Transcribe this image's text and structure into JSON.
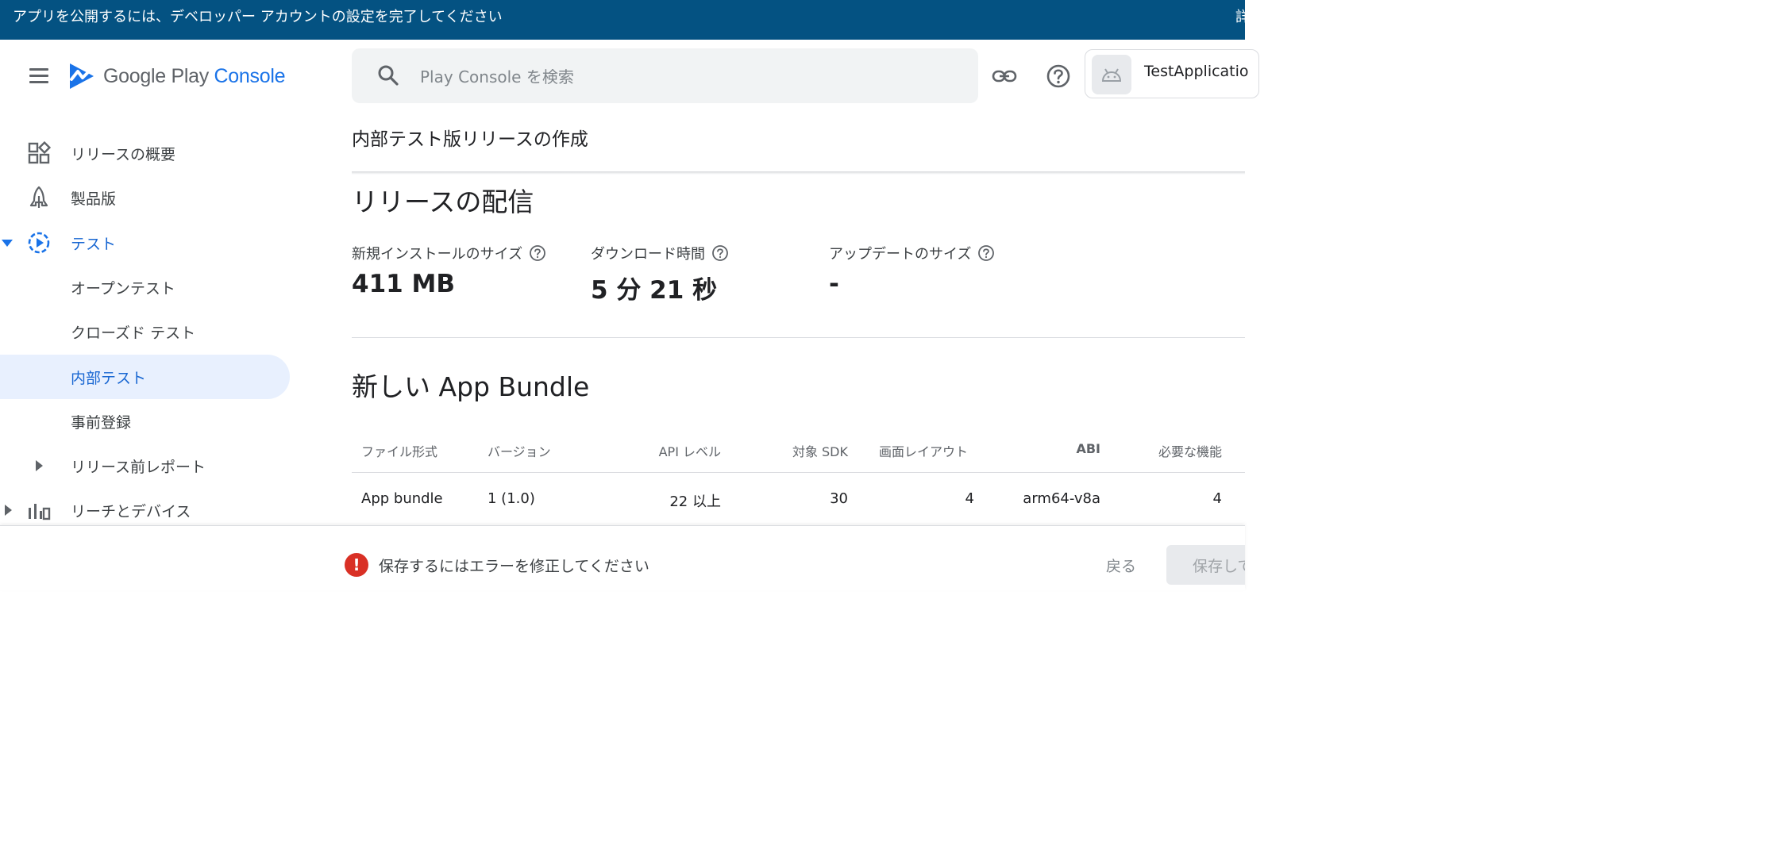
{
  "banner": {
    "text": "アプリを公開するには、デベロッパー アカウントの設定を完了してください",
    "link_partial": "詳"
  },
  "header": {
    "logo_text_main": "Google Play ",
    "logo_text_accent": "Console",
    "search_placeholder": "Play Console を検索",
    "app_name": "TestApplicatio"
  },
  "sidebar": {
    "items": [
      {
        "label": "リリースの概要",
        "icon": "dashboard-icon"
      },
      {
        "label": "製品版",
        "icon": "production-icon"
      },
      {
        "label": "テスト",
        "icon": "testing-icon"
      },
      {
        "label": "オープンテスト"
      },
      {
        "label": "クローズド テスト"
      },
      {
        "label": "内部テスト"
      },
      {
        "label": "事前登録"
      },
      {
        "label": "リリース前レポート"
      },
      {
        "label": "リーチとデバイス",
        "icon": "bar-chart-icon"
      }
    ]
  },
  "main": {
    "page_title": "内部テスト版リリースの作成",
    "delivery_heading": "リリースの配信",
    "metrics": [
      {
        "label": "新規インストールのサイズ",
        "value": "411 MB"
      },
      {
        "label": "ダウンロード時間",
        "value": "5 分 21 秒"
      },
      {
        "label": "アップデートのサイズ",
        "value": "-"
      }
    ],
    "bundle_heading": "新しい App Bundle",
    "table": {
      "headers": [
        "ファイル形式",
        "バージョン",
        "API レベル",
        "対象 SDK",
        "画面レイアウト",
        "ABI",
        "必要な機能"
      ],
      "row": [
        "App bundle",
        "1 (1.0)",
        "22 以上",
        "30",
        "4",
        "arm64-v8a",
        "4"
      ]
    }
  },
  "bottom": {
    "error_icon_glyph": "!",
    "error_text": "保存するにはエラーを修正してください",
    "back_label": "戻る",
    "save_label": "保存して"
  },
  "colors": {
    "banner": "#045282",
    "accent": "#1a73e8",
    "selected_bg": "#e8f0fe",
    "error": "#d93025"
  }
}
